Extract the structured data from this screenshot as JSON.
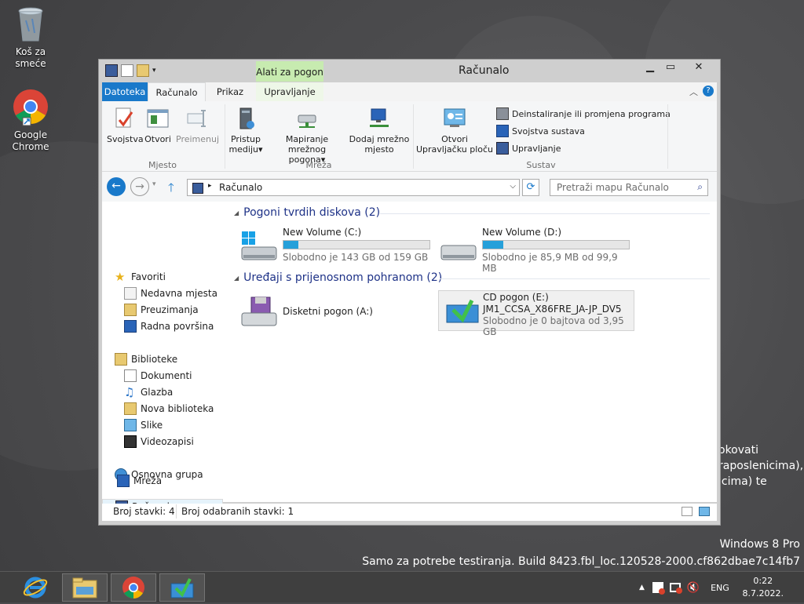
{
  "desktop": {
    "icons": [
      {
        "label": "Koš za smeće"
      },
      {
        "label": "Google Chrome"
      }
    ],
    "background_lines": [
      "okovati",
      "raposlenicima),",
      "icima) te"
    ],
    "watermark": {
      "edition": "Windows 8 Pro",
      "build": "Samo za potrebe testiranja. Build 8423.fbl_loc.120528-2000.cf862dbae7c14fb7"
    }
  },
  "window": {
    "title": "Računalo",
    "context_tab": "Alati za pogon",
    "tabs": {
      "file": "Datoteka",
      "computer": "Računalo",
      "view": "Prikaz",
      "manage": "Upravljanje"
    },
    "ribbon": {
      "location": {
        "label": "Mjesto",
        "properties": "Svojstva",
        "open": "Otvori",
        "rename": "Preimenuj"
      },
      "network": {
        "label": "Mreža",
        "access_media_1": "Pristup",
        "access_media_2": "mediju",
        "map_drive_1": "Mapiranje mrežnog",
        "map_drive_2": "pogona",
        "add_location_1": "Dodaj mrežno",
        "add_location_2": "mjesto"
      },
      "system": {
        "label": "Sustav",
        "open_cp_1": "Otvori",
        "open_cp_2": "Upravljačku ploču",
        "uninstall": "Deinstaliranje ili promjena programa",
        "sys_props": "Svojstva sustava",
        "manage": "Upravljanje"
      }
    },
    "address": {
      "path": "Računalo",
      "search_placeholder": "Pretraži mapu Računalo"
    },
    "nav": {
      "favorites": "Favoriti",
      "recent": "Nedavna mjesta",
      "downloads": "Preuzimanja",
      "desktop": "Radna površina",
      "libraries": "Biblioteke",
      "documents": "Dokumenti",
      "music": "Glazba",
      "new_library": "Nova biblioteka",
      "pictures": "Slike",
      "videos": "Videozapisi",
      "homegroup": "Osnovna grupa",
      "computer": "Računalo",
      "network": "Mreža"
    },
    "content": {
      "hdd_section": "Pogoni tvrdih diskova (2)",
      "removable_section": "Uređaji s prijenosnom pohranom (2)",
      "drives": {
        "c": {
          "name": "New Volume (C:)",
          "free": "Slobodno je 143 GB od 159 GB",
          "used_fraction": 0.1
        },
        "d": {
          "name": "New Volume (D:)",
          "free": "Slobodno je 85,9 MB od 99,9 MB",
          "used_fraction": 0.14
        },
        "a": {
          "name": "Disketni pogon (A:)"
        },
        "e": {
          "name": "CD pogon (E:)",
          "label": "JM1_CCSA_X86FRE_JA-JP_DV5",
          "free": "Slobodno je 0 bajtova od 3,95 GB"
        }
      }
    },
    "status": {
      "items": "Broj stavki: 4",
      "selected": "Broj odabranih stavki: 1"
    }
  },
  "taskbar": {
    "lang": "ENG",
    "time": "0:22",
    "date": "8.7.2022."
  },
  "colors": {
    "accent": "#1979ca",
    "progress": "#26a0da",
    "context_tab": "#c7ebb0",
    "section_title": "#1e3287"
  }
}
